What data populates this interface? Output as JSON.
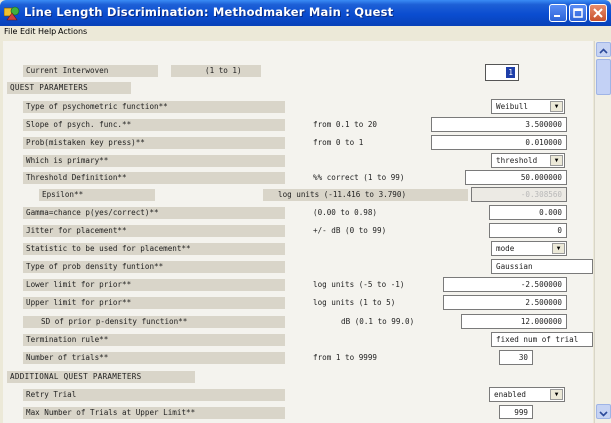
{
  "window": {
    "title": "Line Length Discrimination: Methodmaker Main : Quest",
    "app_icon": "shapes-icon",
    "controls": [
      "minimize-icon",
      "maximize-icon",
      "close-icon"
    ]
  },
  "menu": {
    "file": "File",
    "edit": "Edit",
    "help": "Help",
    "actions": "Actions"
  },
  "current": {
    "label": "Current Interwoven",
    "range": "(1 to 1)",
    "value": "1"
  },
  "sections": {
    "quest": "QUEST PARAMETERS",
    "additional": "ADDITIONAL QUEST PARAMETERS"
  },
  "rows": {
    "psych_type": {
      "label": "Type of psychometric function**",
      "value": "Weibull"
    },
    "slope": {
      "label": "Slope of psych. func.**",
      "range": "from 0.1 to 20",
      "value": "3.500000"
    },
    "prob_mistaken": {
      "label": "Prob(mistaken key press)**",
      "range": "from 0 to 1",
      "value": "0.010000"
    },
    "primary": {
      "label": "Which is primary**",
      "value": "threshold"
    },
    "threshold_def": {
      "label": "Threshold Definition**",
      "range": "%% correct (1 to 99)",
      "value": "50.000000"
    },
    "epsilon": {
      "label": "Epsilon**",
      "range": "log units (-11.416 to 3.790)",
      "value": "-0.308560"
    },
    "gamma": {
      "label": "Gamma=chance p(yes/correct)**",
      "range": "(0.00 to 0.98)",
      "value": "0.000"
    },
    "jitter": {
      "label": "Jitter for placement**",
      "range": "+/- dB (0 to 99)",
      "value": "0"
    },
    "statistic": {
      "label": "Statistic to be used for placement**",
      "value": "mode"
    },
    "prob_density": {
      "label": "Type of prob density funtion**",
      "value": "Gaussian"
    },
    "lower_prior": {
      "label": "Lower limit for prior**",
      "range": "log units (-5 to -1)",
      "value": "-2.500000"
    },
    "upper_prior": {
      "label": "Upper limit for prior**",
      "range": "log units (1 to 5)",
      "value": "2.500000"
    },
    "sd_prior": {
      "label": "SD of prior p-density function**",
      "range": "dB (0.1 to 99.0)",
      "value": "12.000000"
    },
    "termination": {
      "label": "Termination rule**",
      "value": "fixed num of trial"
    },
    "num_trials": {
      "label": "Number of trials**",
      "range": "from 1 to 9999",
      "value": "30"
    },
    "retry_trial": {
      "label": "Retry Trial",
      "value": "enabled"
    },
    "max_trials_upper": {
      "label": "Max Number of Trials at Upper Limit**",
      "value": "999"
    }
  }
}
